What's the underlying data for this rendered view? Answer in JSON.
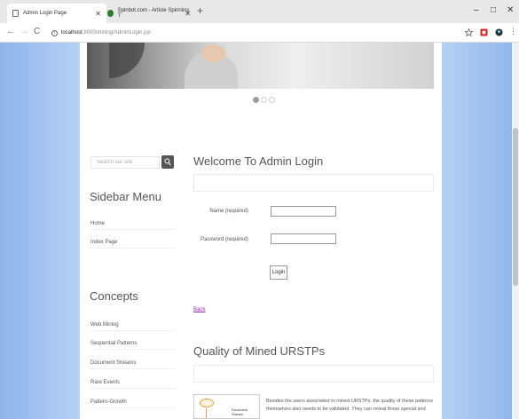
{
  "browser": {
    "tabs": [
      {
        "title": "Admin Login Page",
        "active": true,
        "icon": "document-icon"
      },
      {
        "title": "Spinbot.com - Article Spinning, T",
        "active": false,
        "icon": "spinbot-icon"
      }
    ],
    "new_tab_label": "+",
    "window_controls": {
      "minimize": "–",
      "maximize": "□",
      "close": "✕"
    },
    "address": {
      "host": "localhost",
      "path": ":8000/mining/AdminLogin.jsp"
    },
    "nav": {
      "back": "←",
      "forward": "→",
      "reload": "C"
    },
    "accent_color": "#d32f2f"
  },
  "sidebar": {
    "search_placeholder": "Search our site",
    "menu_heading": "Sidebar Menu",
    "menu_items": [
      "Home",
      "Index Page"
    ],
    "concepts_heading": "Concepts",
    "concept_items": [
      "Web Mining",
      "Sequential Patterns",
      "Document Streams",
      "Rare Events",
      "Pattern-Growth"
    ]
  },
  "main": {
    "login_heading": "Welcome To Admin Login",
    "name_label": "Name (required)",
    "password_label": "Password (required)",
    "login_button": "Login",
    "back_link": "Back",
    "quality_heading": "Quality of Mined URSTPs",
    "article_image_label": "Document Stream",
    "article_text": "Besides the users associated to mined URSTPs, the quality of these patterns themselves also needs to be validated. They can reveal those special and"
  },
  "slider": {
    "dot_count": 3,
    "active_dot": 1
  },
  "colors": {
    "page_background": "#b8d3f5",
    "link_visited": "#9c27b0"
  }
}
